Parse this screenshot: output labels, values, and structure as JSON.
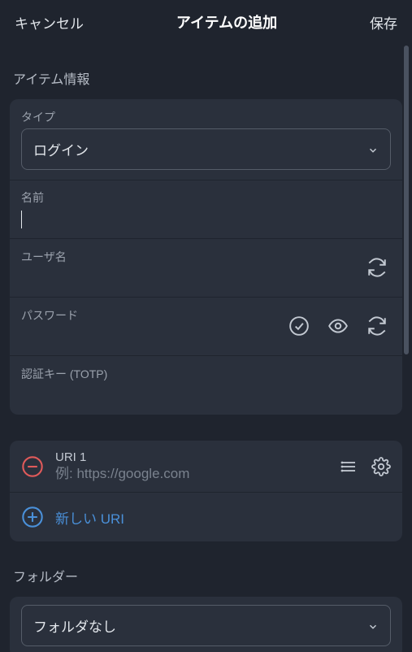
{
  "header": {
    "cancel": "キャンセル",
    "title": "アイテムの追加",
    "save": "保存"
  },
  "section": {
    "item_info": "アイテム情報"
  },
  "fields": {
    "type_label": "タイプ",
    "type_value": "ログイン",
    "name_label": "名前",
    "name_value": "",
    "username_label": "ユーザ名",
    "username_value": "",
    "password_label": "パスワード",
    "password_value": "",
    "totp_label": "認証キー (TOTP)",
    "totp_value": ""
  },
  "uri": {
    "label": "URI 1",
    "placeholder": "例: https://google.com",
    "new_label": "新しい URI"
  },
  "folder": {
    "label": "フォルダー",
    "value": "フォルダなし"
  }
}
